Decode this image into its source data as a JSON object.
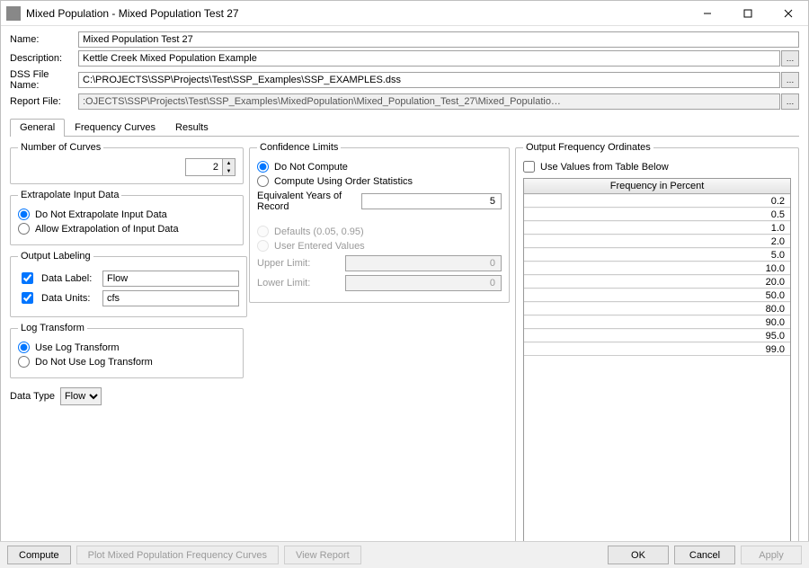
{
  "window": {
    "title": "Mixed Population - Mixed Population Test 27"
  },
  "form": {
    "name_label": "Name:",
    "name_value": "Mixed Population Test 27",
    "desc_label": "Description:",
    "desc_value": "Kettle Creek Mixed Population Example",
    "dss_label": "DSS File Name:",
    "dss_value": "C:\\PROJECTS\\SSP\\Projects\\Test\\SSP_Examples\\SSP_EXAMPLES.dss",
    "report_label": "Report File:",
    "report_value": ":OJECTS\\SSP\\Projects\\Test\\SSP_Examples\\MixedPopulation\\Mixed_Population_Test_27\\Mixed_Populatio…",
    "browse": "…"
  },
  "tabs": [
    {
      "label": "General"
    },
    {
      "label": "Frequency Curves"
    },
    {
      "label": "Results"
    }
  ],
  "numcurves": {
    "legend": "Number of Curves",
    "value": "2"
  },
  "extrapolate": {
    "legend": "Extrapolate Input Data",
    "opt1": "Do Not Extrapolate Input Data",
    "opt2": "Allow Extrapolation of Input Data"
  },
  "outlabel": {
    "legend": "Output Labeling",
    "data_label": "Data Label:",
    "data_label_value": "Flow",
    "data_units": "Data Units:",
    "data_units_value": "cfs"
  },
  "logtrans": {
    "legend": "Log Transform",
    "opt1": "Use Log Transform",
    "opt2": "Do Not Use Log Transform"
  },
  "datatype": {
    "label": "Data Type",
    "value": "Flow"
  },
  "conf": {
    "legend": "Confidence Limits",
    "opt1": "Do Not Compute",
    "opt2": "Compute Using Order Statistics",
    "eq_years_label": "Equivalent Years of Record",
    "eq_years_value": "5",
    "defaults": "Defaults (0.05, 0.95)",
    "user": "User Entered Values",
    "upper": "Upper Limit:",
    "upper_val": "0",
    "lower": "Lower Limit:",
    "lower_val": "0"
  },
  "ordinates": {
    "legend": "Output Frequency Ordinates",
    "use_table": "Use Values from Table Below",
    "header": "Frequency in Percent",
    "rows": [
      "0.2",
      "0.5",
      "1.0",
      "2.0",
      "5.0",
      "10.0",
      "20.0",
      "50.0",
      "80.0",
      "90.0",
      "95.0",
      "99.0"
    ]
  },
  "buttons": {
    "compute": "Compute",
    "plot": "Plot Mixed Population Frequency Curves",
    "view": "View Report",
    "ok": "OK",
    "cancel": "Cancel",
    "apply": "Apply"
  }
}
